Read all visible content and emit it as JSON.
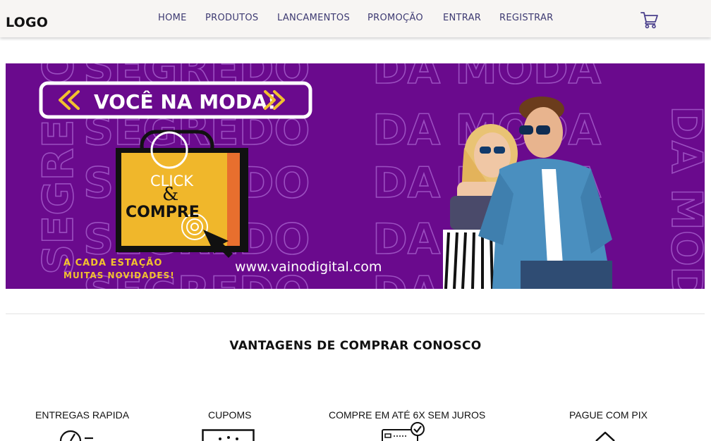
{
  "header": {
    "logo": "LOGO",
    "nav": [
      "HOME",
      "PRODUTOS",
      "LANCAMENTOS",
      "PROMOÇÃO",
      "ENTRAR",
      "REGISTRAR"
    ],
    "cart_icon": "shopping-cart-icon"
  },
  "banner": {
    "headline": "VOCÊ NA MODA!",
    "background_word_1": "SEGREDO",
    "background_word_2": "DA MODA",
    "bag_line_1": "CLICK",
    "bag_line_2": "&",
    "bag_line_3": "COMPRE",
    "tagline_1": "A CADA ESTAÇÃO",
    "tagline_2": "MUITAS NOVIDADES!",
    "url": "www.vainodigital.com",
    "colors": {
      "background": "#6a0a8d",
      "accent": "#f2c12e",
      "bag": "#f0b72b"
    }
  },
  "advantages": {
    "title": "VANTAGENS DE COMPRAR CONOSCO",
    "items": [
      {
        "label": "ENTREGAS RAPIDA",
        "icon": "stopwatch-icon"
      },
      {
        "label": "CUPOMS",
        "icon": "coupon-icon"
      },
      {
        "label": "COMPRE EM ATÉ 6X SEM JUROS",
        "icon": "credit-card-check-icon"
      },
      {
        "label": "PAGUE COM PIX",
        "icon": "pix-icon"
      }
    ]
  }
}
